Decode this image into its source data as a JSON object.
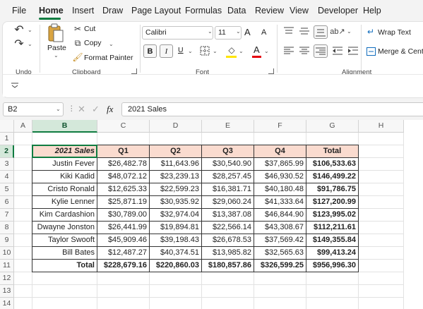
{
  "menu": {
    "items": [
      "File",
      "Home",
      "Insert",
      "Draw",
      "Page Layout",
      "Formulas",
      "Data",
      "Review",
      "View",
      "Developer",
      "Help"
    ]
  },
  "ribbon": {
    "undo_group": "Undo",
    "clipboard": {
      "paste": "Paste",
      "cut": "Cut",
      "copy": "Copy",
      "format_painter": "Format Painter",
      "label": "Clipboard"
    },
    "font": {
      "name": "Calibri",
      "size": "11",
      "bold": "B",
      "italic": "I",
      "underline": "U",
      "label": "Font",
      "grow": "A",
      "shrink": "A",
      "font_color": "A"
    },
    "alignment": {
      "wrap_text": "Wrap Text",
      "merge": "Merge & Cente",
      "label": "Alignment"
    }
  },
  "formula_bar": {
    "name_box": "B2",
    "fx": "fx",
    "content": "2021 Sales"
  },
  "grid": {
    "columns": [
      "A",
      "B",
      "C",
      "D",
      "E",
      "F",
      "G",
      "H"
    ],
    "selected_column": "B",
    "selected_row": "2",
    "rows": [
      "1",
      "2",
      "3",
      "4",
      "5",
      "6",
      "7",
      "8",
      "9",
      "10",
      "11",
      "12",
      "13",
      "14"
    ],
    "header_cells": [
      "2021 Sales",
      "Q1",
      "Q2",
      "Q3",
      "Q4",
      "Total"
    ],
    "data": [
      [
        "Justin Fever",
        "$26,482.78",
        "$11,643.96",
        "$30,540.90",
        "$37,865.99",
        "$106,533.63"
      ],
      [
        "Kiki Kadid",
        "$48,072.12",
        "$23,239.13",
        "$28,257.45",
        "$46,930.52",
        "$146,499.22"
      ],
      [
        "Cristo Ronald",
        "$12,625.33",
        "$22,599.23",
        "$16,381.71",
        "$40,180.48",
        "$91,786.75"
      ],
      [
        "Kylie Lenner",
        "$25,871.19",
        "$30,935.92",
        "$29,060.24",
        "$41,333.64",
        "$127,200.99"
      ],
      [
        "Kim Cardashion",
        "$30,789.00",
        "$32,974.04",
        "$13,387.08",
        "$46,844.90",
        "$123,995.02"
      ],
      [
        "Dwayne Jonston",
        "$26,441.99",
        "$19,894.81",
        "$22,566.14",
        "$43,308.67",
        "$112,211.61"
      ],
      [
        "Taylor Swooft",
        "$45,909.46",
        "$39,198.43",
        "$26,678.53",
        "$37,569.42",
        "$149,355.84"
      ],
      [
        "Bill Bates",
        "$12,487.27",
        "$40,374.51",
        "$13,985.82",
        "$32,565.63",
        "$99,413.24"
      ]
    ],
    "total_row": [
      "Total",
      "$228,679.16",
      "$220,860.03",
      "$180,857.86",
      "$326,599.25",
      "$956,996.30"
    ]
  }
}
